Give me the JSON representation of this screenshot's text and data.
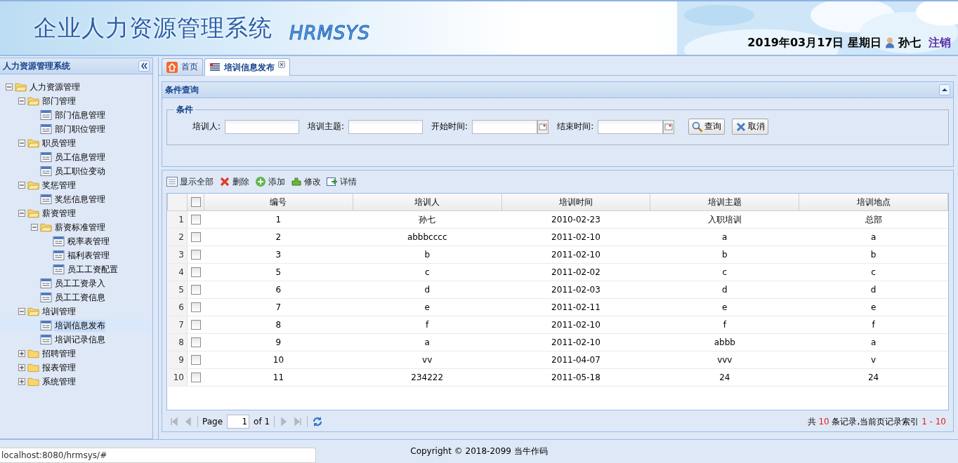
{
  "header": {
    "title": "企业人力资源管理系统",
    "logo_text": "HRMSYS",
    "date": "2019年03月17日 星期日",
    "user": "孙七",
    "logout": "注销"
  },
  "sidebar": {
    "title": "人力资源管理系统",
    "tree": [
      {
        "label": "人力资源管理",
        "kind": "folder",
        "expanded": true,
        "selected": false,
        "children": [
          {
            "label": "部门管理",
            "kind": "folder",
            "expanded": true,
            "selected": false,
            "children": [
              {
                "label": "部门信息管理",
                "kind": "leaf",
                "selected": false
              },
              {
                "label": "部门职位管理",
                "kind": "leaf",
                "selected": false
              }
            ]
          },
          {
            "label": "职员管理",
            "kind": "folder",
            "expanded": true,
            "selected": false,
            "children": [
              {
                "label": "员工信息管理",
                "kind": "leaf",
                "selected": false
              },
              {
                "label": "员工职位变动",
                "kind": "leaf",
                "selected": false
              }
            ]
          },
          {
            "label": "奖惩管理",
            "kind": "folder",
            "expanded": true,
            "selected": false,
            "children": [
              {
                "label": "奖惩信息管理",
                "kind": "leaf",
                "selected": false
              }
            ]
          },
          {
            "label": "薪资管理",
            "kind": "folder",
            "expanded": true,
            "selected": false,
            "children": [
              {
                "label": "薪资标准管理",
                "kind": "folder",
                "expanded": true,
                "selected": false,
                "children": [
                  {
                    "label": "税率表管理",
                    "kind": "leaf",
                    "selected": false
                  },
                  {
                    "label": "福利表管理",
                    "kind": "leaf",
                    "selected": false
                  },
                  {
                    "label": "员工工资配置",
                    "kind": "leaf",
                    "selected": false
                  }
                ]
              },
              {
                "label": "员工工资录入",
                "kind": "leaf",
                "selected": false
              },
              {
                "label": "员工工资信息",
                "kind": "leaf",
                "selected": false
              }
            ]
          },
          {
            "label": "培训管理",
            "kind": "folder",
            "expanded": true,
            "selected": false,
            "children": [
              {
                "label": "培训信息发布",
                "kind": "leaf",
                "selected": true
              },
              {
                "label": "培训记录信息",
                "kind": "leaf",
                "selected": false
              }
            ]
          },
          {
            "label": "招聘管理",
            "kind": "folder",
            "expanded": false,
            "selected": false
          },
          {
            "label": "报表管理",
            "kind": "folder",
            "expanded": false,
            "selected": false
          },
          {
            "label": "系统管理",
            "kind": "folder",
            "expanded": false,
            "selected": false
          }
        ]
      }
    ]
  },
  "tabs": [
    {
      "label": "首页",
      "kind": "home",
      "selected": false
    },
    {
      "label": "培训信息发布",
      "kind": "page",
      "selected": true
    }
  ],
  "query_panel": {
    "title": "条件查询",
    "legend": "条件",
    "fields": [
      {
        "label": "培训人:",
        "kind": "text"
      },
      {
        "label": "培训主题:",
        "kind": "text"
      },
      {
        "label": "开始时间:",
        "kind": "date"
      },
      {
        "label": "结束时间:",
        "kind": "date"
      }
    ],
    "buttons": [
      {
        "label": "查询",
        "kind": "search"
      },
      {
        "label": "取消",
        "kind": "cancel"
      }
    ]
  },
  "toolbar": [
    {
      "label": "显示全部",
      "kind": "list"
    },
    {
      "label": "删除",
      "kind": "delete"
    },
    {
      "label": "添加",
      "kind": "add"
    },
    {
      "label": "修改",
      "kind": "edit"
    },
    {
      "label": "详情",
      "kind": "detail"
    }
  ],
  "table": {
    "header_checked": false,
    "columns": [
      "编号",
      "培训人",
      "培训时间",
      "培训主题",
      "培训地点"
    ],
    "rows": [
      {
        "row_number": "1",
        "checked": false,
        "cells": [
          "1",
          "孙七",
          "2010-02-23",
          "入职培训",
          "总部"
        ]
      },
      {
        "row_number": "2",
        "checked": false,
        "cells": [
          "2",
          "abbbcccc",
          "2011-02-10",
          "a",
          "a"
        ]
      },
      {
        "row_number": "3",
        "checked": false,
        "cells": [
          "3",
          "b",
          "2011-02-10",
          "b",
          "b"
        ]
      },
      {
        "row_number": "4",
        "checked": false,
        "cells": [
          "5",
          "c",
          "2011-02-02",
          "c",
          "c"
        ]
      },
      {
        "row_number": "5",
        "checked": false,
        "cells": [
          "6",
          "d",
          "2011-02-03",
          "d",
          "d"
        ]
      },
      {
        "row_number": "6",
        "checked": false,
        "cells": [
          "7",
          "e",
          "2011-02-11",
          "e",
          "e"
        ]
      },
      {
        "row_number": "7",
        "checked": false,
        "cells": [
          "8",
          "f",
          "2011-02-10",
          "f",
          "f"
        ]
      },
      {
        "row_number": "8",
        "checked": false,
        "cells": [
          "9",
          "a",
          "2011-02-10",
          "abbb",
          "a"
        ]
      },
      {
        "row_number": "9",
        "checked": false,
        "cells": [
          "10",
          "vv",
          "2011-04-07",
          "vvv",
          "v"
        ]
      },
      {
        "row_number": "10",
        "checked": false,
        "cells": [
          "11",
          "234222",
          "2011-05-18",
          "24",
          "24"
        ]
      }
    ]
  },
  "pager": {
    "nav": [
      {
        "kind": "first",
        "disabled": true
      },
      {
        "kind": "prev",
        "disabled": true
      }
    ],
    "page_label": "Page",
    "page": "1",
    "of_label": "of 1",
    "nav_after": [
      {
        "kind": "next",
        "disabled": true
      },
      {
        "kind": "last",
        "disabled": true
      }
    ],
    "summary_prefix": "共",
    "total": "10",
    "summary_middle": "条记录,当前页记录索引",
    "range": "1 - 10"
  },
  "footer": {
    "copyright": "Copyright © 2018-2099 当牛作码",
    "status_url": "localhost:8080/hrmsys/#"
  }
}
